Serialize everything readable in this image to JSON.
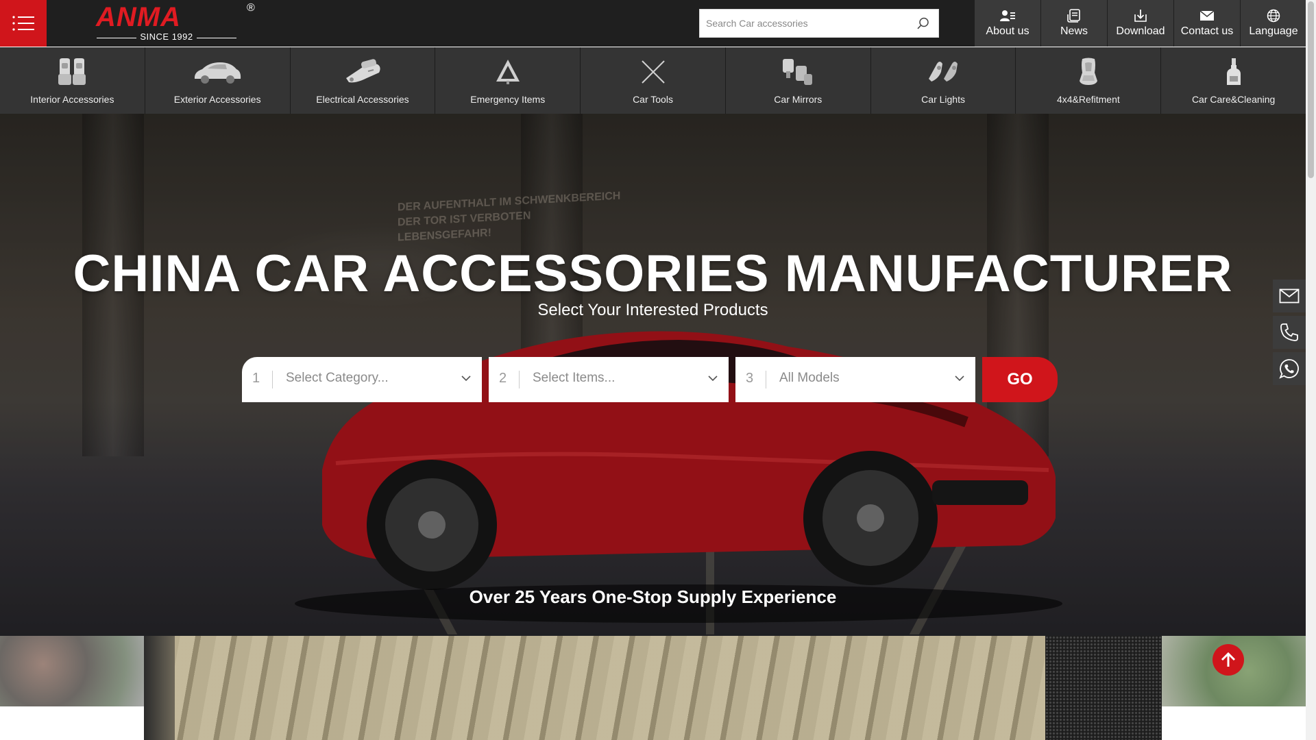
{
  "header": {
    "menu_icon": "hamburger-menu-icon",
    "logo": {
      "wordmark": "ANMA",
      "registered": "®",
      "since": "SINCE 1992"
    },
    "search": {
      "placeholder": "Search Car accessories",
      "value": "",
      "icon": "search-icon"
    },
    "top_links": [
      {
        "label": "About us",
        "icon": "about-user-icon"
      },
      {
        "label": "News",
        "icon": "news-icon"
      },
      {
        "label": "Download",
        "icon": "download-icon"
      },
      {
        "label": "Contact us",
        "icon": "mail-icon"
      },
      {
        "label": "Language",
        "icon": "globe-icon"
      }
    ]
  },
  "categories": [
    {
      "label": "Interior Accessories",
      "icon": "car-seat-covers-icon"
    },
    {
      "label": "Exterior Accessories",
      "icon": "car-cover-icon"
    },
    {
      "label": "Electrical Accessories",
      "icon": "vacuum-cleaner-icon"
    },
    {
      "label": "Emergency Items",
      "icon": "warning-triangle-icon"
    },
    {
      "label": "Car Tools",
      "icon": "crossed-tools-icon"
    },
    {
      "label": "Car Mirrors",
      "icon": "mirror-icon"
    },
    {
      "label": "Car Lights",
      "icon": "car-lights-icon"
    },
    {
      "label": "4x4&Refitment",
      "icon": "bucket-seat-icon"
    },
    {
      "label": "Car Care&Cleaning",
      "icon": "spray-bottle-icon"
    }
  ],
  "hero": {
    "title": "CHINA CAR ACCESSORIES MANUFACTURER",
    "subtitle": "Select Your Interested Products",
    "wall_text": [
      "DER AUFENTHALT IM SCHWENKBEREICH",
      "DER TOR IST VERBOTEN",
      "LEBENSGEFAHR!"
    ],
    "selectors": [
      {
        "num": "1",
        "text": "Select Category..."
      },
      {
        "num": "2",
        "text": "Select Items..."
      },
      {
        "num": "3",
        "text": "All Models"
      }
    ],
    "go_label": "GO",
    "tagline": "Over 25 Years One-Stop Supply Experience"
  },
  "floating_contacts": [
    {
      "icon": "mail-icon"
    },
    {
      "icon": "phone-icon"
    },
    {
      "icon": "whatsapp-icon"
    }
  ],
  "colors": {
    "brand_red": "#d0151b",
    "header_bg": "#1f1f1f",
    "nav_bg": "#343434"
  }
}
